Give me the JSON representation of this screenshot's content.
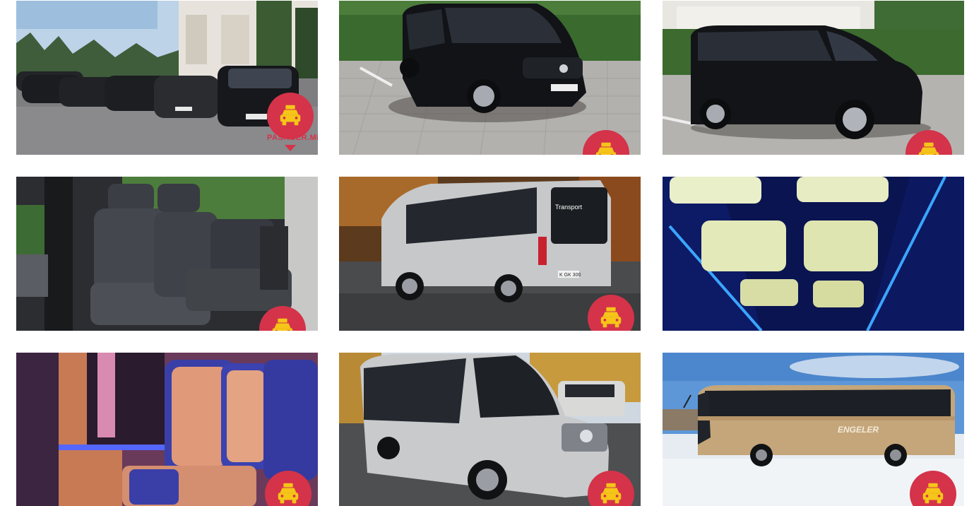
{
  "gallery": {
    "accent_color": "#d4334a",
    "logo_icon": "taxi-car-icon",
    "tiles": [
      {
        "id": 1,
        "subject": "car-fleet",
        "badge_text": "PASAGER.MD"
      },
      {
        "id": 2,
        "subject": "black-minivan-front"
      },
      {
        "id": 3,
        "subject": "black-minivan-side"
      },
      {
        "id": 4,
        "subject": "minivan-interior-seats"
      },
      {
        "id": 5,
        "subject": "silver-minibus-rear",
        "rear_window_text": "Transport",
        "plate_text": "K GK 300"
      },
      {
        "id": 6,
        "subject": "minibus-ceiling-lights"
      },
      {
        "id": 7,
        "subject": "minibus-interior-seats-led"
      },
      {
        "id": 8,
        "subject": "silver-minibus-front"
      },
      {
        "id": 9,
        "subject": "coach-bus-side",
        "bus_brand_text": "ENGELER"
      }
    ]
  }
}
